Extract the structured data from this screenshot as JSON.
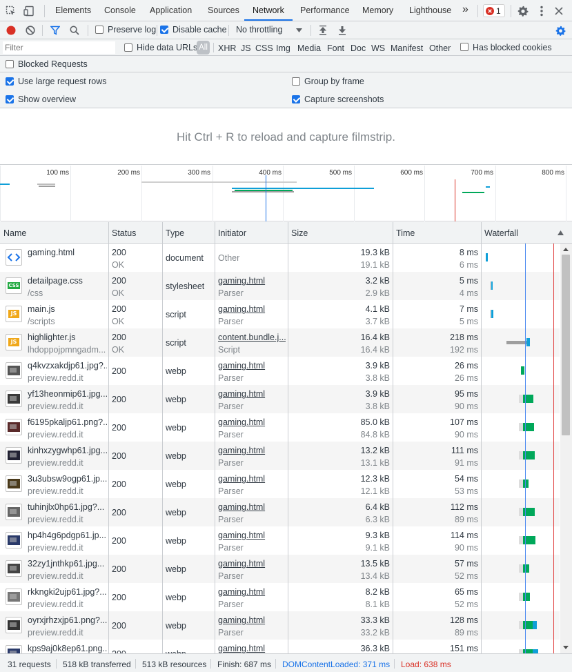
{
  "tabs": [
    "Elements",
    "Console",
    "Application",
    "Sources",
    "Network",
    "Performance",
    "Memory",
    "Lighthouse"
  ],
  "active_tab": "Network",
  "more_tabs_glyph": "»",
  "error_count": "1",
  "icons": {
    "inspect": "inspect-icon",
    "device": "device-toolbar-icon",
    "record": "record-icon",
    "clear": "clear-icon",
    "filter": "filter-icon",
    "search": "search-icon",
    "upload": "import-har-icon",
    "download": "export-har-icon",
    "settings": "gear-icon",
    "menu": "kebab-menu-icon",
    "close": "close-icon"
  },
  "toolbar": {
    "preserve_log": "Preserve log",
    "disable_cache": "Disable cache",
    "throttling": "No throttling"
  },
  "filter": {
    "placeholder": "Filter",
    "hide_data_urls": "Hide data URLs",
    "types": [
      "All",
      "XHR",
      "JS",
      "CSS",
      "Img",
      "Media",
      "Font",
      "Doc",
      "WS",
      "Manifest",
      "Other"
    ],
    "has_blocked_cookies": "Has blocked cookies",
    "blocked_requests": "Blocked Requests"
  },
  "settings": {
    "large_rows": "Use large request rows",
    "show_overview": "Show overview",
    "group_by_frame": "Group by frame",
    "capture_screenshots": "Capture screenshots"
  },
  "filmstrip_message": "Hit Ctrl + R to reload and capture filmstrip.",
  "overview_ticks": [
    "100 ms",
    "200 ms",
    "300 ms",
    "400 ms",
    "500 ms",
    "600 ms",
    "700 ms",
    "800 ms"
  ],
  "columns": [
    "Name",
    "Status",
    "Type",
    "Initiator",
    "Size",
    "Time",
    "Waterfall"
  ],
  "rows": [
    {
      "name": "gaming.html",
      "sub": "",
      "icon": "html-file-icon",
      "status": "200",
      "status_text": "OK",
      "type": "document",
      "initiator": "Other",
      "initiator_sub": "",
      "size": "19.3 kB",
      "size_sub": "19.1 kB",
      "time": "8 ms",
      "time_sub": "6 ms"
    },
    {
      "name": "detailpage.css",
      "sub": "/css",
      "icon": "css-file-icon",
      "status": "200",
      "status_text": "OK",
      "type": "stylesheet",
      "initiator": "gaming.html",
      "initiator_sub": "Parser",
      "size": "3.2 kB",
      "size_sub": "2.9 kB",
      "time": "5 ms",
      "time_sub": "4 ms"
    },
    {
      "name": "main.js",
      "sub": "/scripts",
      "icon": "js-file-icon",
      "status": "200",
      "status_text": "OK",
      "type": "script",
      "initiator": "gaming.html",
      "initiator_sub": "Parser",
      "size": "4.1 kB",
      "size_sub": "3.7 kB",
      "time": "7 ms",
      "time_sub": "5 ms"
    },
    {
      "name": "highlighter.js",
      "sub": "lhdoppojpmngadm...",
      "icon": "js-file-icon",
      "status": "200",
      "status_text": "OK",
      "type": "script",
      "initiator": "content.bundle.j...",
      "initiator_sub": "Script",
      "size": "16.4 kB",
      "size_sub": "16.4 kB",
      "time": "218 ms",
      "time_sub": "192 ms"
    },
    {
      "name": "q4kvzxakdjp61.jpg?...",
      "sub": "preview.redd.it",
      "icon": "image-thumbnail-icon",
      "status": "200",
      "status_text": "",
      "type": "webp",
      "initiator": "gaming.html",
      "initiator_sub": "Parser",
      "size": "3.9 kB",
      "size_sub": "3.8 kB",
      "time": "26 ms",
      "time_sub": "26 ms"
    },
    {
      "name": "yf13heonmip61.jpg...",
      "sub": "preview.redd.it",
      "icon": "image-thumbnail-icon",
      "status": "200",
      "status_text": "",
      "type": "webp",
      "initiator": "gaming.html",
      "initiator_sub": "Parser",
      "size": "3.9 kB",
      "size_sub": "3.8 kB",
      "time": "95 ms",
      "time_sub": "90 ms"
    },
    {
      "name": "f6195pkaljp61.png?...",
      "sub": "preview.redd.it",
      "icon": "image-thumbnail-icon",
      "status": "200",
      "status_text": "",
      "type": "webp",
      "initiator": "gaming.html",
      "initiator_sub": "Parser",
      "size": "85.0 kB",
      "size_sub": "84.8 kB",
      "time": "107 ms",
      "time_sub": "90 ms"
    },
    {
      "name": "kinhxzygwhp61.jpg...",
      "sub": "preview.redd.it",
      "icon": "image-thumbnail-icon",
      "status": "200",
      "status_text": "",
      "type": "webp",
      "initiator": "gaming.html",
      "initiator_sub": "Parser",
      "size": "13.2 kB",
      "size_sub": "13.1 kB",
      "time": "111 ms",
      "time_sub": "91 ms"
    },
    {
      "name": "3u3ubsw9ogp61.jp...",
      "sub": "preview.redd.it",
      "icon": "image-thumbnail-icon",
      "status": "200",
      "status_text": "",
      "type": "webp",
      "initiator": "gaming.html",
      "initiator_sub": "Parser",
      "size": "12.3 kB",
      "size_sub": "12.1 kB",
      "time": "54 ms",
      "time_sub": "53 ms"
    },
    {
      "name": "tuhinjlx0hp61.jpg?...",
      "sub": "preview.redd.it",
      "icon": "image-thumbnail-icon",
      "status": "200",
      "status_text": "",
      "type": "webp",
      "initiator": "gaming.html",
      "initiator_sub": "Parser",
      "size": "6.4 kB",
      "size_sub": "6.3 kB",
      "time": "112 ms",
      "time_sub": "89 ms"
    },
    {
      "name": "hp4h4g6pdgp61.jp...",
      "sub": "preview.redd.it",
      "icon": "image-thumbnail-icon",
      "status": "200",
      "status_text": "",
      "type": "webp",
      "initiator": "gaming.html",
      "initiator_sub": "Parser",
      "size": "9.3 kB",
      "size_sub": "9.1 kB",
      "time": "114 ms",
      "time_sub": "90 ms"
    },
    {
      "name": "32zy1jnthkp61.jpg...",
      "sub": "preview.redd.it",
      "icon": "image-thumbnail-icon",
      "status": "200",
      "status_text": "",
      "type": "webp",
      "initiator": "gaming.html",
      "initiator_sub": "Parser",
      "size": "13.5 kB",
      "size_sub": "13.4 kB",
      "time": "57 ms",
      "time_sub": "52 ms"
    },
    {
      "name": "rkkngki2ujp61.jpg?...",
      "sub": "preview.redd.it",
      "icon": "image-thumbnail-icon",
      "status": "200",
      "status_text": "",
      "type": "webp",
      "initiator": "gaming.html",
      "initiator_sub": "Parser",
      "size": "8.2 kB",
      "size_sub": "8.1 kB",
      "time": "65 ms",
      "time_sub": "52 ms"
    },
    {
      "name": "oyrxjrhzxjp61.png?...",
      "sub": "preview.redd.it",
      "icon": "image-thumbnail-icon",
      "status": "200",
      "status_text": "",
      "type": "webp",
      "initiator": "gaming.html",
      "initiator_sub": "Parser",
      "size": "33.3 kB",
      "size_sub": "33.2 kB",
      "time": "128 ms",
      "time_sub": "89 ms"
    },
    {
      "name": "kps9aj0k8ep61.png...",
      "sub": "",
      "icon": "image-thumbnail-icon",
      "status": "200",
      "status_text": "",
      "type": "webp",
      "initiator": "gaming.html",
      "initiator_sub": "",
      "size": "36.3 kB",
      "size_sub": "",
      "time": "151 ms",
      "time_sub": ""
    }
  ],
  "summary": {
    "requests": "31 requests",
    "transferred": "518 kB transferred",
    "resources": "513 kB resources",
    "finish": "Finish: 687 ms",
    "dcl": "DOMContentLoaded: 371 ms",
    "load": "Load: 638 ms"
  },
  "colors": {
    "accent": "#1a73e8",
    "dcl": "#1a73e8",
    "load": "#d93025",
    "waiting": "#00a85a",
    "download": "#0f9fd8"
  }
}
